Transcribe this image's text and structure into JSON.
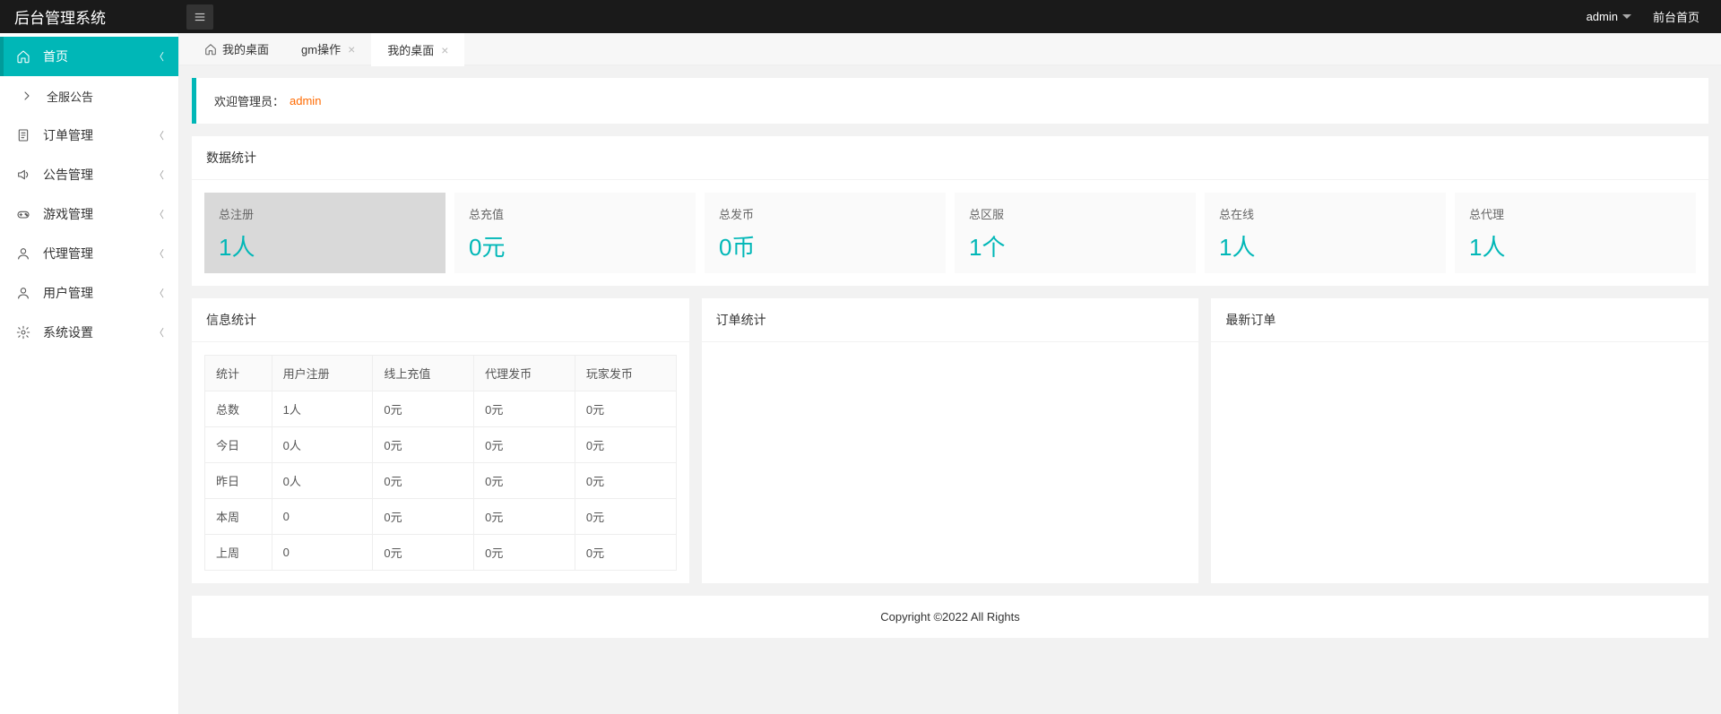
{
  "app_title": "后台管理系统",
  "header": {
    "user": "admin",
    "front_link": "前台首页"
  },
  "sidebar": [
    {
      "label": "首页",
      "icon": "home",
      "active": true,
      "hasChildren": true
    },
    {
      "label": "全服公告",
      "icon": "chev-right",
      "sub": true
    },
    {
      "label": "订单管理",
      "icon": "doc",
      "hasChildren": true
    },
    {
      "label": "公告管理",
      "icon": "speaker",
      "hasChildren": true
    },
    {
      "label": "游戏管理",
      "icon": "game",
      "hasChildren": true
    },
    {
      "label": "代理管理",
      "icon": "user",
      "hasChildren": true
    },
    {
      "label": "用户管理",
      "icon": "user",
      "hasChildren": true
    },
    {
      "label": "系统设置",
      "icon": "gear",
      "hasChildren": true
    }
  ],
  "tabs": [
    {
      "label": "我的桌面",
      "home": true,
      "closable": false
    },
    {
      "label": "gm操作",
      "closable": true
    },
    {
      "label": "我的桌面",
      "closable": true,
      "active": true
    }
  ],
  "welcome": {
    "prefix": "欢迎管理员：",
    "name": "admin"
  },
  "stats_panel_title": "数据统计",
  "cards": [
    {
      "label": "总注册",
      "value": "1人",
      "highlight": true
    },
    {
      "label": "总充值",
      "value": "0元"
    },
    {
      "label": "总发币",
      "value": "0币"
    },
    {
      "label": "总区服",
      "value": "1个"
    },
    {
      "label": "总在线",
      "value": "1人"
    },
    {
      "label": "总代理",
      "value": "1人"
    }
  ],
  "info_panel_title": "信息统计",
  "info_table": {
    "headers": [
      "统计",
      "用户注册",
      "线上充值",
      "代理发币",
      "玩家发币"
    ],
    "rows": [
      [
        "总数",
        "1人",
        "0元",
        "0元",
        "0元"
      ],
      [
        "今日",
        "0人",
        "0元",
        "0元",
        "0元"
      ],
      [
        "昨日",
        "0人",
        "0元",
        "0元",
        "0元"
      ],
      [
        "本周",
        "0",
        "0元",
        "0元",
        "0元"
      ],
      [
        "上周",
        "0",
        "0元",
        "0元",
        "0元"
      ]
    ]
  },
  "order_stats_title": "订单统计",
  "latest_order_title": "最新订单",
  "footer": "Copyright ©2022 All Rights"
}
